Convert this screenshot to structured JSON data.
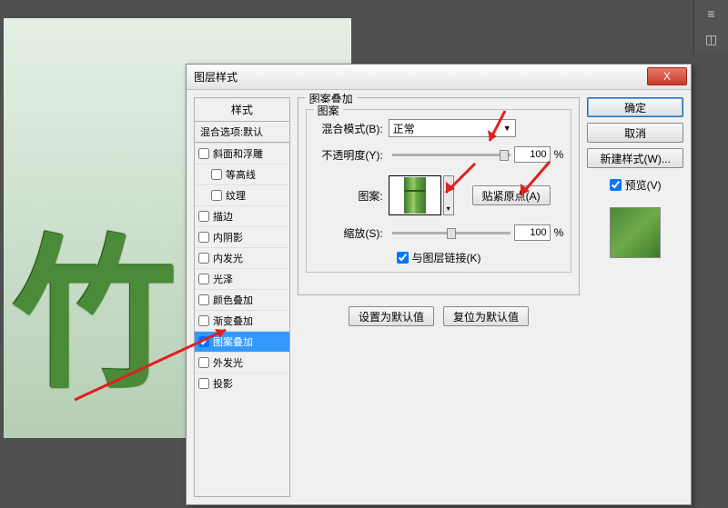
{
  "dialog": {
    "title": "图层样式",
    "close": "X"
  },
  "styles": {
    "header": "样式",
    "blend_options": "混合选项:默认",
    "items": [
      {
        "label": "斜面和浮雕",
        "checked": false
      },
      {
        "label": "等高线",
        "checked": false,
        "indent": true
      },
      {
        "label": "纹理",
        "checked": false,
        "indent": true
      },
      {
        "label": "描边",
        "checked": false
      },
      {
        "label": "内阴影",
        "checked": false
      },
      {
        "label": "内发光",
        "checked": false
      },
      {
        "label": "光泽",
        "checked": false
      },
      {
        "label": "颜色叠加",
        "checked": false
      },
      {
        "label": "渐变叠加",
        "checked": false
      },
      {
        "label": "图案叠加",
        "checked": true,
        "selected": true
      },
      {
        "label": "外发光",
        "checked": false
      },
      {
        "label": "投影",
        "checked": false
      }
    ]
  },
  "overlay": {
    "group_title": "图案叠加",
    "pattern_title": "图案",
    "blend_mode_label": "混合模式(B):",
    "blend_mode_value": "正常",
    "opacity_label": "不透明度(Y):",
    "opacity_value": "100",
    "opacity_unit": "%",
    "pattern_label": "图案:",
    "snap_button": "贴紧原点(A)",
    "scale_label": "缩放(S):",
    "scale_value": "100",
    "scale_unit": "%",
    "link_label": "与图层链接(K)",
    "set_default": "设置为默认值",
    "reset_default": "复位为默认值"
  },
  "buttons": {
    "ok": "确定",
    "cancel": "取消",
    "new_style": "新建样式(W)...",
    "preview": "预览(V)"
  },
  "canvas": {
    "char": "竹"
  }
}
